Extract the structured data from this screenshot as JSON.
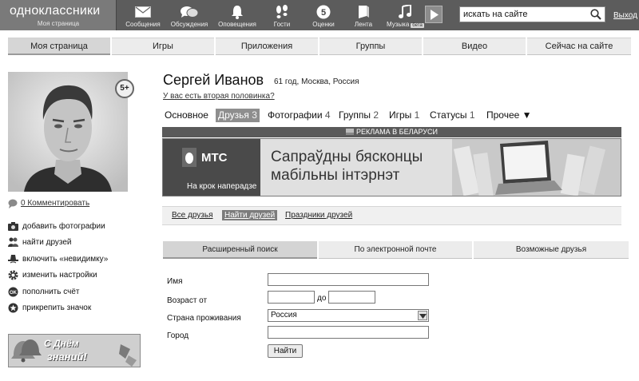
{
  "topbar": {
    "logo_title": "одноклассники",
    "logo_subtitle": "Моя страница",
    "nav": [
      {
        "label": "Сообщения",
        "icon": "envelope-icon"
      },
      {
        "label": "Обсуждения",
        "icon": "chat-bubbles-icon"
      },
      {
        "label": "Оповещения",
        "icon": "bell-icon"
      },
      {
        "label": "Гости",
        "icon": "footprints-icon"
      },
      {
        "label": "Оценки",
        "icon": "rating-five-icon",
        "badge": "5"
      },
      {
        "label": "Лента",
        "icon": "feed-icon"
      },
      {
        "label": "Музыка",
        "icon": "music-note-icon",
        "beta": "бета"
      }
    ],
    "search_value": "искать на сайте",
    "exit_label": "Выход"
  },
  "subnav": [
    "Моя страница",
    "Игры",
    "Приложения",
    "Группы",
    "Видео",
    "Сейчас на сайте"
  ],
  "left": {
    "age_badge": "5+",
    "comments_label": "0 Комментировать",
    "actions": [
      {
        "label": "добавить фотографии",
        "icon": "camera-icon"
      },
      {
        "label": "найти друзей",
        "icon": "people-icon"
      },
      {
        "label": "включить «невидимку»",
        "icon": "invisible-hat-icon"
      },
      {
        "label": "изменить настройки",
        "icon": "gear-icon"
      },
      {
        "label": "пополнить счёт",
        "icon": "ok-coin-icon"
      },
      {
        "label": "прикрепить значок",
        "icon": "star-badge-icon"
      }
    ],
    "banner_line1": "С Днём",
    "banner_line2": "знаний!"
  },
  "profile": {
    "name": "Сергей Иванов",
    "meta": "61 год, Москва, Россия",
    "partner_link": "У вас есть вторая половинка?",
    "tabs": [
      {
        "label": "Основное",
        "count": ""
      },
      {
        "label": "Друзья",
        "count": "3"
      },
      {
        "label": "Фотографии",
        "count": "4"
      },
      {
        "label": "Группы",
        "count": "2"
      },
      {
        "label": "Игры",
        "count": "1"
      },
      {
        "label": "Статусы",
        "count": "1"
      },
      {
        "label": "Прочее ▼",
        "count": ""
      }
    ]
  },
  "ad": {
    "label": "РЕКЛАМА В БЕЛАРУСИ",
    "brand": "МТС",
    "slogan": "На крок наперадзе",
    "headline1": "Сапраўдны бясконцы",
    "headline2": "мабільны інтэрнэт"
  },
  "friends_subnav": [
    "Все друзья",
    "Найти друзей",
    "Праздники друзей"
  ],
  "search_tabs": [
    "Расширенный поиск",
    "По электронной почте",
    "Возможные друзья"
  ],
  "form": {
    "name_label": "Имя",
    "age_label": "Возраст от",
    "age_to": "до",
    "country_label": "Страна проживания",
    "country_value": "Россия",
    "city_label": "Город",
    "submit_label": "Найти"
  }
}
